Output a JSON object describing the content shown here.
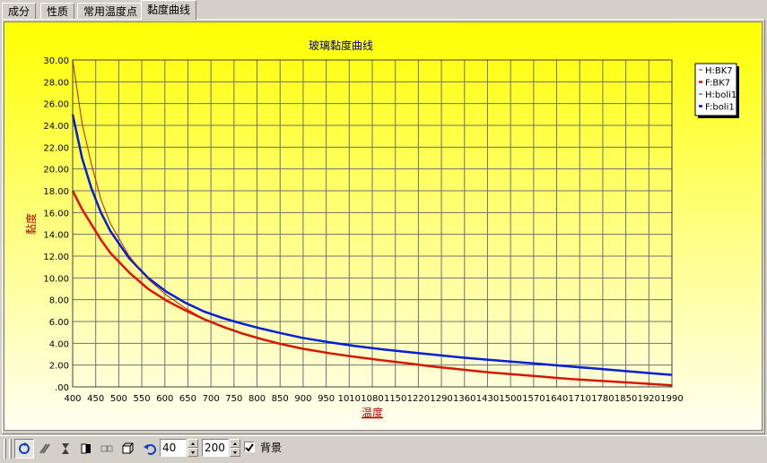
{
  "tabs": [
    {
      "label": "成分",
      "active": false
    },
    {
      "label": "性质",
      "active": false
    },
    {
      "label": "常用温度点",
      "active": false
    },
    {
      "label": "黏度曲线",
      "active": true
    }
  ],
  "chart_data": {
    "type": "line",
    "title": "玻璃黏度曲线",
    "xlabel": "温度",
    "ylabel": "黏度",
    "xlim": [
      400,
      1990
    ],
    "ylim": [
      0,
      30
    ],
    "x_tick_labels": [
      "400",
      "450",
      "500",
      "550",
      "600",
      "650",
      "700",
      "750",
      "800",
      "850",
      "900",
      "950",
      "1010",
      "1080",
      "1150",
      "1220",
      "1290",
      "1360",
      "1430",
      "1500",
      "1570",
      "1640",
      "1710",
      "1780",
      "1850",
      "1920",
      "1990"
    ],
    "y_tick_labels": [
      ".00",
      "2.00",
      "4.00",
      "6.00",
      "8.00",
      "10.00",
      "12.00",
      "14.00",
      "16.00",
      "18.00",
      "20.00",
      "22.00",
      "24.00",
      "26.00",
      "28.00",
      "30.00"
    ],
    "grid": true,
    "legend_position": "top-right",
    "series": [
      {
        "name": "H:BK7",
        "color": "#c02000",
        "width": 1,
        "x": [
          400,
          425,
          450,
          475,
          500,
          550,
          600,
          650,
          700,
          750,
          800,
          850,
          900,
          950,
          1010,
          1080,
          1150,
          1220,
          1290,
          1360,
          1430,
          1500,
          1570,
          1640,
          1710,
          1780,
          1850,
          1920,
          1990
        ],
        "y": [
          30,
          24.2,
          20.4,
          17.2,
          15.0,
          12.0,
          9.9,
          8.4,
          7.2,
          6.2,
          5.5,
          4.9,
          4.4,
          3.95,
          3.5,
          3.1,
          2.75,
          2.45,
          2.15,
          1.85,
          1.6,
          1.35,
          1.15,
          0.95,
          0.75,
          0.6,
          0.45,
          0.3,
          0.15
        ]
      },
      {
        "name": "F:BK7",
        "color": "#e81000",
        "width": 2.5,
        "x": [
          400,
          425,
          450,
          475,
          500,
          550,
          600,
          650,
          700,
          750,
          800,
          850,
          900,
          950,
          1010,
          1080,
          1150,
          1220,
          1290,
          1360,
          1430,
          1500,
          1570,
          1640,
          1710,
          1780,
          1850,
          1920,
          1990
        ],
        "y": [
          18,
          16.3,
          14.9,
          13.5,
          12.3,
          10.5,
          9.0,
          7.9,
          7.0,
          6.2,
          5.5,
          4.9,
          4.4,
          3.95,
          3.5,
          3.1,
          2.75,
          2.45,
          2.15,
          1.85,
          1.6,
          1.35,
          1.15,
          0.95,
          0.75,
          0.6,
          0.45,
          0.3,
          0.15
        ]
      },
      {
        "name": "H:boli1",
        "color": "#0030c0",
        "width": 1,
        "x": [
          400,
          425,
          450,
          475,
          500,
          550,
          600,
          650,
          700,
          750,
          800,
          850,
          900,
          950,
          1010,
          1080,
          1150,
          1220,
          1290,
          1360,
          1430,
          1500,
          1570,
          1640,
          1710,
          1780,
          1850,
          1920,
          1990
        ],
        "y": [
          25,
          21.0,
          18.2,
          16.0,
          14.3,
          11.8,
          10.0,
          8.7,
          7.7,
          6.9,
          6.3,
          5.8,
          5.35,
          4.95,
          4.5,
          4.1,
          3.75,
          3.45,
          3.2,
          2.95,
          2.7,
          2.5,
          2.3,
          2.1,
          1.9,
          1.7,
          1.5,
          1.3,
          1.1
        ]
      },
      {
        "name": "F:boli1",
        "color": "#0010e8",
        "width": 2.5,
        "x": [
          400,
          425,
          450,
          475,
          500,
          550,
          600,
          650,
          700,
          750,
          800,
          850,
          900,
          950,
          1010,
          1080,
          1150,
          1220,
          1290,
          1360,
          1430,
          1500,
          1570,
          1640,
          1710,
          1780,
          1850,
          1920,
          1990
        ],
        "y": [
          25,
          21.0,
          18.2,
          16.0,
          14.3,
          11.8,
          10.0,
          8.7,
          7.7,
          6.9,
          6.3,
          5.8,
          5.35,
          4.95,
          4.5,
          4.1,
          3.75,
          3.45,
          3.2,
          2.95,
          2.7,
          2.5,
          2.3,
          2.1,
          1.9,
          1.7,
          1.5,
          1.3,
          1.1
        ]
      }
    ]
  },
  "toolbar": {
    "icons": [
      "rotate-icon",
      "move-icon",
      "hourglass-icon",
      "gradient-icon",
      "copy-icon",
      "3d-box-icon",
      "undo-icon"
    ],
    "spin1_value": "40",
    "spin2_value": "200",
    "background_checked": true,
    "background_label": "背景"
  }
}
